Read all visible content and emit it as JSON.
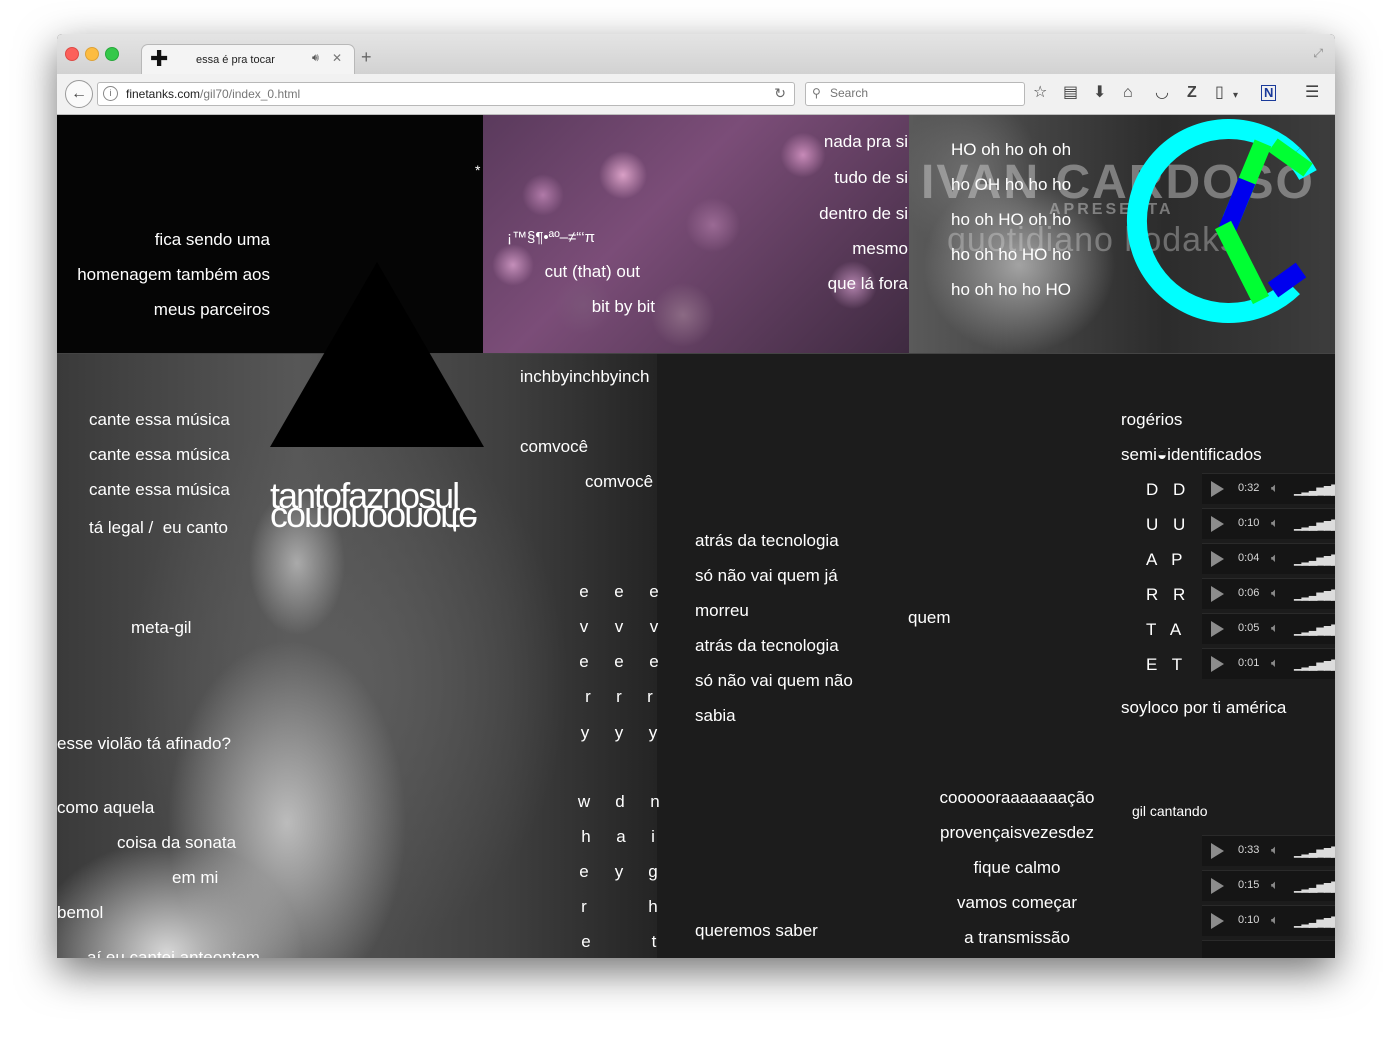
{
  "tab": {
    "title": "essa é pra tocar"
  },
  "nav": {
    "url_host": "finetanks.com",
    "url_path": "/gil70/index_0.html",
    "search_placeholder": "Search"
  },
  "top_black": {
    "lines": [
      "fica sendo uma",
      "homenagem também aos",
      "meus parceiros"
    ],
    "star": "*"
  },
  "top_crowd": {
    "right_lines": [
      "nada pra si",
      "tudo de si",
      "dentro de si",
      "mesmo",
      "que lá fora"
    ],
    "symbols": "¡™§¶•ªº–≠“‘π",
    "cut": "cut (that) out",
    "bit": "bit by bit"
  },
  "top_ivan": {
    "logo": "IVAN CARDOSO",
    "apresenta": "APRESENTA",
    "subtitle": "quotidiano kodaks",
    "ho_lines": [
      "HO oh ho oh oh",
      "ho OH ho ho ho",
      "ho oh HO oh ho",
      "ho oh ho HO ho",
      "ho oh ho ho HO"
    ]
  },
  "left": {
    "cante": [
      "cante essa música",
      "cante essa música",
      "cante essa música"
    ],
    "ta_legal": "tá legal /  eu canto",
    "big1": "tantofaznosul",
    "big2": "comonoonorte",
    "meta": "meta-gil",
    "violao": "esse violão tá afinado?",
    "como": "como aquela",
    "coisa": "coisa da sonata",
    "em": "em mi",
    "bemol": "bemol",
    "cut": "aí eu cantei anteontem"
  },
  "mid": {
    "inch": "inchbyinchbyinch",
    "comvoce1": "comvocê",
    "comvoce2": "comvocê",
    "every": [
      [
        "e",
        "v",
        "e",
        "r",
        "y"
      ],
      [
        "e",
        "v",
        "e",
        "r",
        "y"
      ],
      [
        "e",
        "v",
        "e",
        "r",
        "y"
      ]
    ],
    "when": [
      [
        "w",
        "h",
        "e",
        "r",
        "e"
      ],
      [
        "d",
        "a",
        "y",
        ""
      ],
      [
        "n",
        "i",
        "g",
        "h",
        "t"
      ]
    ],
    "tech": [
      "atrás da tecnologia",
      "só não vai quem já",
      "morreu",
      "atrás da tecnologia",
      "só não vai quem não",
      "sabia"
    ],
    "queremos": "queremos saber",
    "quem": "quem"
  },
  "right": {
    "rogerios": "rogérios",
    "semi": "semi◒identificados",
    "players": [
      {
        "label": "D D",
        "time": "0:32"
      },
      {
        "label": "U U",
        "time": "0:10"
      },
      {
        "label": "A P",
        "time": "0:04"
      },
      {
        "label": "R R",
        "time": "0:06"
      },
      {
        "label": "T A",
        "time": "0:05"
      },
      {
        "label": "E T",
        "time": "0:01"
      }
    ],
    "soyloco": "soyloco por ti américa",
    "gil": "gil cantando",
    "players2": [
      {
        "time": "0:33"
      },
      {
        "time": "0:15"
      },
      {
        "time": "0:10"
      }
    ],
    "coraacao": [
      "coooooraaaaaaação",
      "provençaisvezesdez",
      "fique calmo",
      "vamos começar",
      "a transmissão"
    ]
  },
  "colors": {
    "logo_cyan": "#00ffff",
    "logo_green": "#00ff33",
    "logo_blue": "#0000ee"
  }
}
